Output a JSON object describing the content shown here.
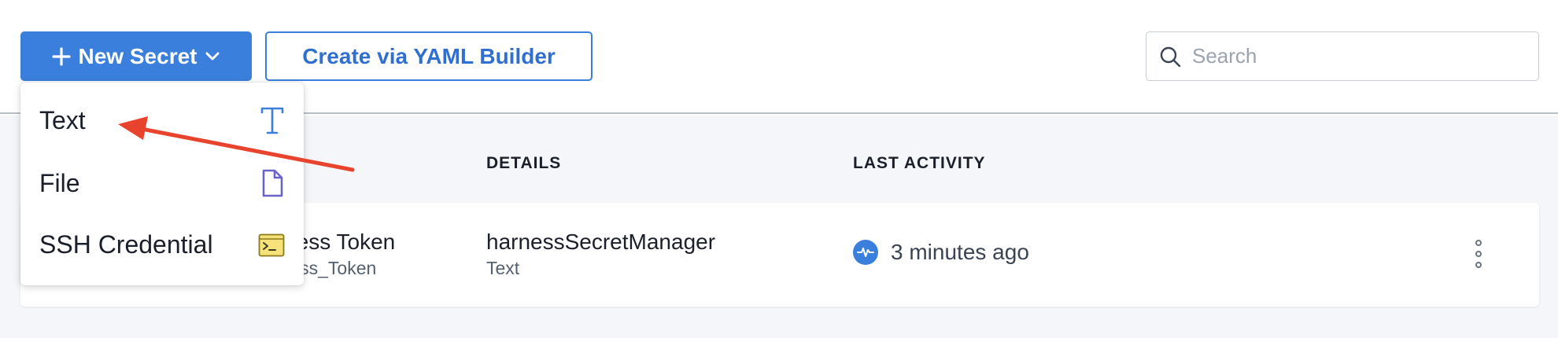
{
  "toolbar": {
    "new_secret_label": "New Secret",
    "yaml_builder_label": "Create via YAML Builder",
    "search_placeholder": "Search"
  },
  "table": {
    "columns": [
      "DETAILS",
      "LAST ACTIVITY"
    ],
    "rows": [
      {
        "name": "Access Token",
        "identifier": "Access_Token",
        "details": "harnessSecretManager",
        "details_type": "Text",
        "last_activity": "3 minutes ago"
      }
    ]
  },
  "dropdown": {
    "items": [
      {
        "label": "Text",
        "icon": "text-type-icon"
      },
      {
        "label": "File",
        "icon": "file-icon"
      },
      {
        "label": "SSH Credential",
        "icon": "terminal-icon"
      }
    ]
  },
  "colors": {
    "primary": "#3a7fdc",
    "annotation_arrow": "#e8432d"
  }
}
